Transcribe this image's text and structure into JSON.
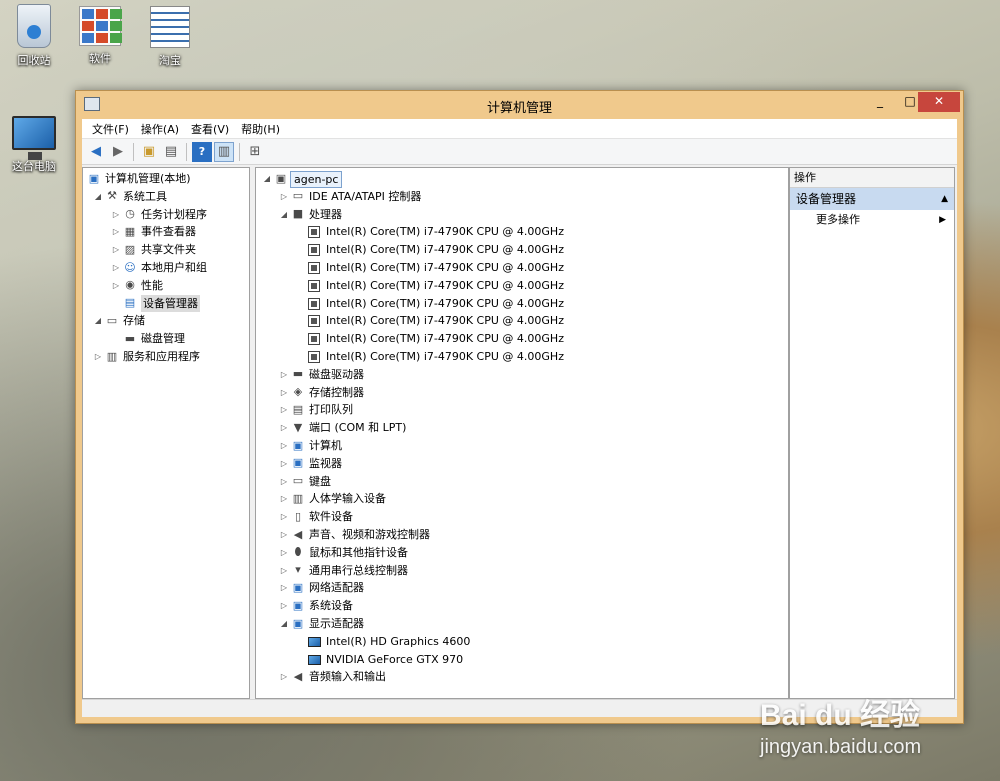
{
  "desktop": {
    "icons": [
      {
        "label": "回收站",
        "icon": "recycle-bin-icon"
      },
      {
        "label": "软件",
        "icon": "software-folder-icon"
      },
      {
        "label": "淘宝",
        "icon": "taobao-shortcut-icon"
      },
      {
        "label": "这台电脑",
        "icon": "this-pc-icon"
      }
    ]
  },
  "window": {
    "title": "计算机管理",
    "controls": {
      "minimize": "_",
      "maximize": "□",
      "close": "✕"
    }
  },
  "menu": [
    "文件(F)",
    "操作(A)",
    "查看(V)",
    "帮助(H)"
  ],
  "toolbar": [
    "back-arrow-icon",
    "forward-arrow-icon",
    "up-folder-icon",
    "show-hide-tree-icon",
    "help-icon",
    "properties-icon",
    "scan-hardware-icon"
  ],
  "tree": {
    "root": "计算机管理(本地)",
    "items": [
      {
        "label": "系统工具",
        "level": 1,
        "expander": "collapse",
        "icon": "tools-icon"
      },
      {
        "label": "任务计划程序",
        "level": 2,
        "expander": "expand",
        "icon": "clock-icon"
      },
      {
        "label": "事件查看器",
        "level": 2,
        "expander": "expand",
        "icon": "event-viewer-icon"
      },
      {
        "label": "共享文件夹",
        "level": 2,
        "expander": "expand",
        "icon": "shared-folder-icon"
      },
      {
        "label": "本地用户和组",
        "level": 2,
        "expander": "expand",
        "icon": "users-icon"
      },
      {
        "label": "性能",
        "level": 2,
        "expander": "expand",
        "icon": "performance-icon"
      },
      {
        "label": "设备管理器",
        "level": 2,
        "expander": "none",
        "icon": "device-manager-icon",
        "selected": true
      },
      {
        "label": "存储",
        "level": 1,
        "expander": "collapse",
        "icon": "storage-icon"
      },
      {
        "label": "磁盘管理",
        "level": 2,
        "expander": "none",
        "icon": "disk-management-icon"
      },
      {
        "label": "服务和应用程序",
        "level": 1,
        "expander": "expand",
        "icon": "services-icon"
      }
    ]
  },
  "devices": {
    "root": "agen-pc",
    "items": [
      {
        "label": "IDE ATA/ATAPI 控制器",
        "level": 1,
        "expander": "expand",
        "icon": "ide-controller-icon"
      },
      {
        "label": "处理器",
        "level": 1,
        "expander": "collapse",
        "icon": "processor-icon"
      },
      {
        "label": "Intel(R) Core(TM) i7-4790K CPU @ 4.00GHz",
        "level": 2,
        "icon": "cpu-icon"
      },
      {
        "label": "Intel(R) Core(TM) i7-4790K CPU @ 4.00GHz",
        "level": 2,
        "icon": "cpu-icon"
      },
      {
        "label": "Intel(R) Core(TM) i7-4790K CPU @ 4.00GHz",
        "level": 2,
        "icon": "cpu-icon"
      },
      {
        "label": "Intel(R) Core(TM) i7-4790K CPU @ 4.00GHz",
        "level": 2,
        "icon": "cpu-icon"
      },
      {
        "label": "Intel(R) Core(TM) i7-4790K CPU @ 4.00GHz",
        "level": 2,
        "icon": "cpu-icon"
      },
      {
        "label": "Intel(R) Core(TM) i7-4790K CPU @ 4.00GHz",
        "level": 2,
        "icon": "cpu-icon"
      },
      {
        "label": "Intel(R) Core(TM) i7-4790K CPU @ 4.00GHz",
        "level": 2,
        "icon": "cpu-icon"
      },
      {
        "label": "Intel(R) Core(TM) i7-4790K CPU @ 4.00GHz",
        "level": 2,
        "icon": "cpu-icon"
      },
      {
        "label": "磁盘驱动器",
        "level": 1,
        "expander": "expand",
        "icon": "disk-drive-icon"
      },
      {
        "label": "存储控制器",
        "level": 1,
        "expander": "expand",
        "icon": "storage-controller-icon"
      },
      {
        "label": "打印队列",
        "level": 1,
        "expander": "expand",
        "icon": "printer-icon"
      },
      {
        "label": "端口 (COM 和 LPT)",
        "level": 1,
        "expander": "expand",
        "icon": "port-icon"
      },
      {
        "label": "计算机",
        "level": 1,
        "expander": "expand",
        "icon": "computer-icon"
      },
      {
        "label": "监视器",
        "level": 1,
        "expander": "expand",
        "icon": "monitor-icon"
      },
      {
        "label": "键盘",
        "level": 1,
        "expander": "expand",
        "icon": "keyboard-icon"
      },
      {
        "label": "人体学输入设备",
        "level": 1,
        "expander": "expand",
        "icon": "hid-icon"
      },
      {
        "label": "软件设备",
        "level": 1,
        "expander": "expand",
        "icon": "software-device-icon"
      },
      {
        "label": "声音、视频和游戏控制器",
        "level": 1,
        "expander": "expand",
        "icon": "sound-icon"
      },
      {
        "label": "鼠标和其他指针设备",
        "level": 1,
        "expander": "expand",
        "icon": "mouse-icon"
      },
      {
        "label": "通用串行总线控制器",
        "level": 1,
        "expander": "expand",
        "icon": "usb-icon"
      },
      {
        "label": "网络适配器",
        "level": 1,
        "expander": "expand",
        "icon": "network-adapter-icon"
      },
      {
        "label": "系统设备",
        "level": 1,
        "expander": "expand",
        "icon": "system-device-icon"
      },
      {
        "label": "显示适配器",
        "level": 1,
        "expander": "collapse",
        "icon": "display-adapter-icon"
      },
      {
        "label": "Intel(R) HD Graphics 4600",
        "level": 2,
        "icon": "display-device-icon"
      },
      {
        "label": "NVIDIA GeForce GTX 970",
        "level": 2,
        "icon": "display-device-icon"
      },
      {
        "label": "音频输入和输出",
        "level": 1,
        "expander": "expand",
        "icon": "audio-io-icon"
      }
    ]
  },
  "actions": {
    "header": "操作",
    "section": "设备管理器",
    "items": [
      "更多操作"
    ]
  },
  "watermark": {
    "logo": "Bai du 经验",
    "url": "jingyan.baidu.com"
  }
}
